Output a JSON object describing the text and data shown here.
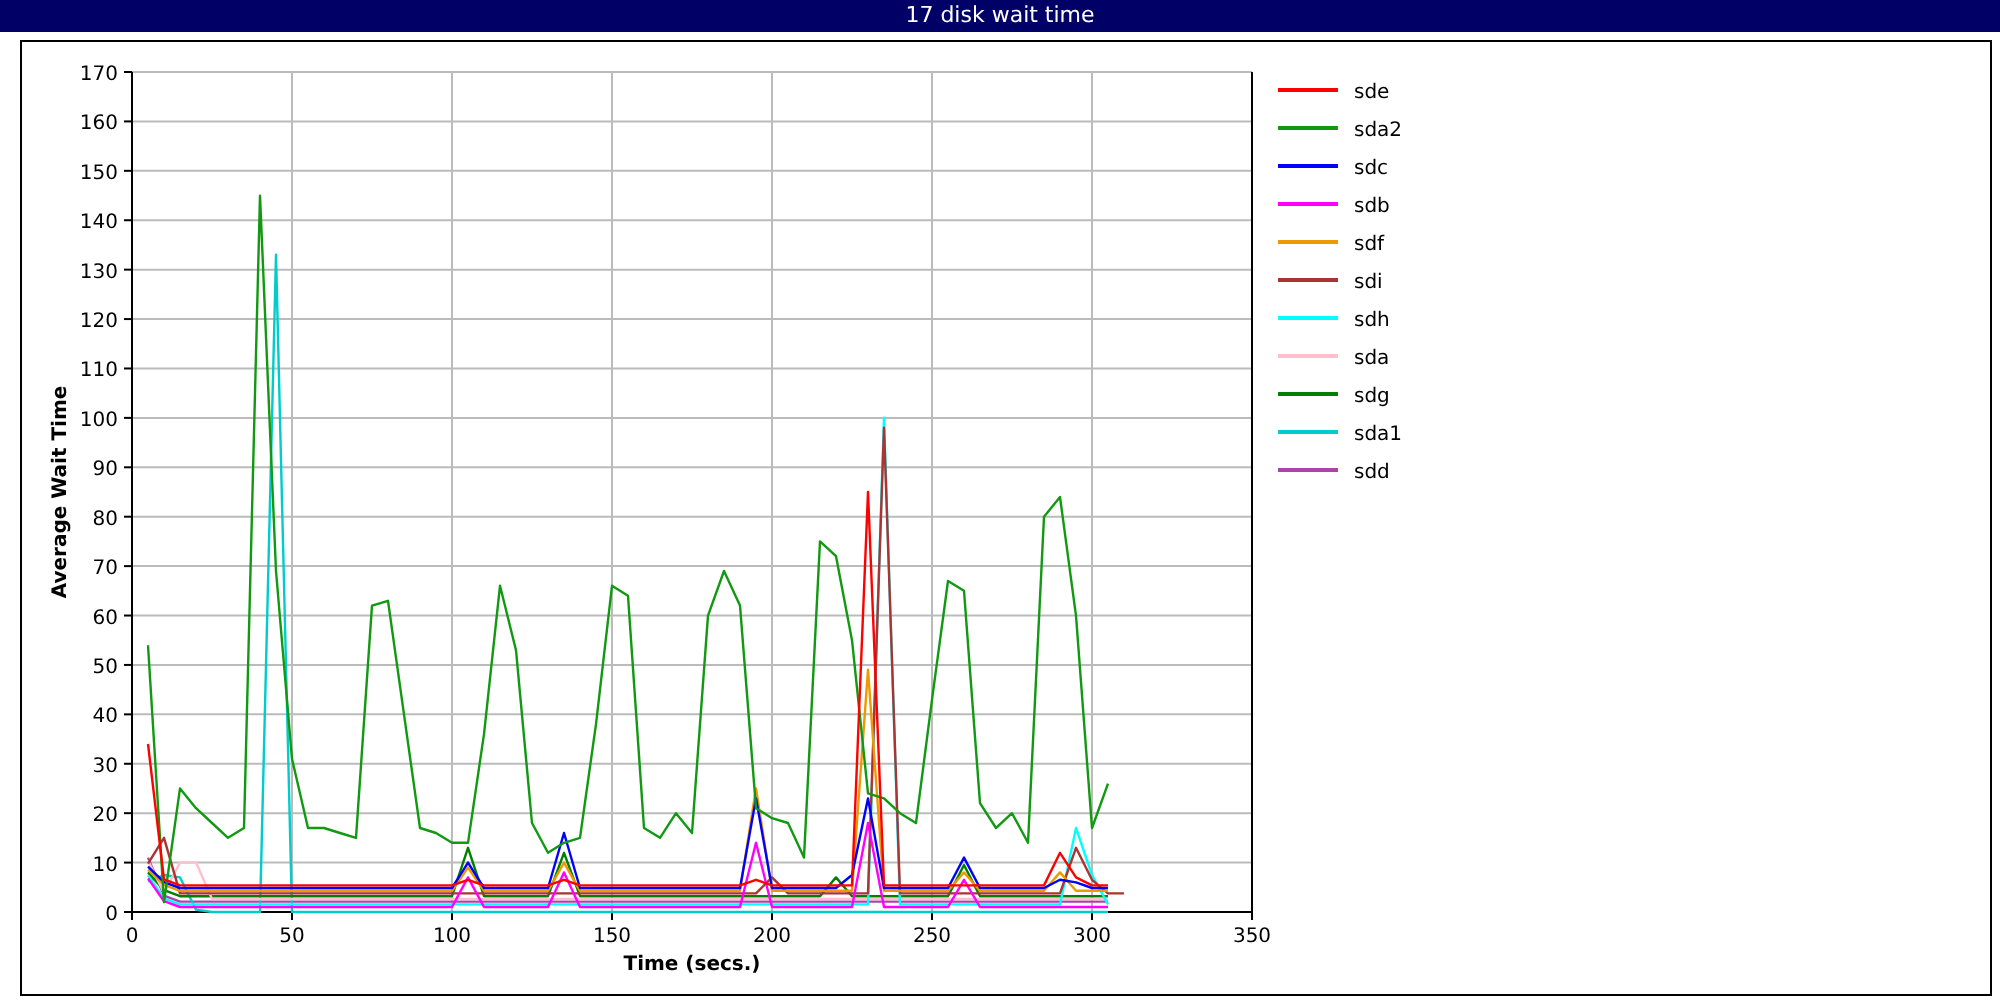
{
  "window": {
    "title": "17 disk wait time"
  },
  "chart": {
    "chart_data": {
      "type": "line",
      "xlabel": "Time (secs.)",
      "ylabel": "Average Wait Time",
      "grid": true,
      "legend": true,
      "x": [
        5,
        10,
        15,
        20,
        25,
        30,
        35,
        40,
        45,
        50,
        55,
        60,
        65,
        70,
        75,
        80,
        85,
        90,
        95,
        100,
        105,
        110,
        115,
        120,
        125,
        130,
        135,
        140,
        145,
        150,
        155,
        160,
        165,
        170,
        175,
        180,
        185,
        190,
        195,
        200,
        205,
        210,
        215,
        220,
        225,
        230,
        235,
        240,
        245,
        250,
        255,
        260,
        265,
        270,
        275,
        280,
        285,
        290,
        295,
        300,
        305,
        310
      ],
      "xlim": [
        0,
        350
      ],
      "ylim": [
        0,
        170
      ],
      "xticks": [
        0,
        50,
        100,
        150,
        200,
        250,
        300,
        350
      ],
      "yticks": [
        0,
        10,
        20,
        30,
        40,
        50,
        60,
        70,
        80,
        90,
        100,
        110,
        120,
        130,
        140,
        150,
        160,
        170
      ],
      "series": [
        {
          "name": "sde",
          "color": "#ff0000",
          "values": [
            34,
            6.6,
            5.4,
            5.4,
            5.4,
            5.4,
            5.4,
            5.4,
            5.4,
            5.4,
            5.4,
            5.4,
            5.4,
            5.4,
            5.4,
            5.4,
            5.4,
            5.4,
            5.4,
            5.4,
            6.5,
            5.4,
            5.4,
            5.4,
            5.4,
            5.4,
            6.5,
            5.4,
            5.4,
            5.4,
            5.4,
            5.4,
            5.4,
            5.4,
            5.4,
            5.4,
            5.4,
            5.4,
            6.5,
            5.4,
            5.4,
            5.4,
            5.4,
            5.4,
            5.4,
            85,
            5.4,
            5.4,
            5.4,
            5.4,
            5.4,
            5.4,
            5.4,
            5.4,
            5.4,
            5.4,
            5.4,
            12,
            7,
            5.4,
            5.4,
            null
          ]
        },
        {
          "name": "sda2",
          "color": "#119911",
          "values": [
            54,
            2,
            25,
            21,
            18,
            15,
            17,
            145,
            69,
            31,
            17,
            17,
            16,
            15,
            62,
            63,
            40,
            17,
            16,
            14,
            14,
            36,
            66,
            53,
            18,
            12,
            14,
            15,
            38,
            66,
            64,
            17,
            15,
            20,
            16,
            60,
            69,
            62,
            21,
            19,
            18,
            11,
            75,
            72,
            55,
            24,
            23,
            20,
            18,
            43,
            67,
            65,
            22,
            17,
            20,
            14,
            80,
            84,
            60,
            17,
            26,
            null
          ]
        },
        {
          "name": "sdc",
          "color": "#0000ff",
          "values": [
            9.2,
            6.05,
            4.85,
            4.85,
            4.85,
            4.85,
            4.85,
            4.85,
            4.85,
            4.85,
            4.85,
            4.85,
            4.85,
            4.85,
            4.85,
            4.85,
            4.85,
            4.85,
            4.85,
            4.85,
            10,
            4.85,
            4.85,
            4.85,
            4.85,
            4.85,
            16,
            4.85,
            4.85,
            4.85,
            4.85,
            4.85,
            4.85,
            4.85,
            4.85,
            4.85,
            4.85,
            4.85,
            23,
            4.85,
            4.85,
            4.85,
            4.85,
            4.85,
            7.5,
            23,
            4.85,
            4.85,
            4.85,
            4.85,
            4.85,
            11,
            4.85,
            4.85,
            4.85,
            4.85,
            4.85,
            6.5,
            6,
            4.85,
            4.85,
            null
          ]
        },
        {
          "name": "sdb",
          "color": "#ff00ff",
          "values": [
            6.8,
            2.2,
            1,
            1,
            1,
            1,
            1,
            1,
            1,
            1,
            1,
            1,
            1,
            1,
            1,
            1,
            1,
            1,
            1,
            1,
            7,
            1,
            1,
            1,
            1,
            1,
            8,
            1,
            1,
            1,
            1,
            1,
            1,
            1,
            1,
            1,
            1,
            1,
            14,
            1,
            1,
            1,
            1,
            1,
            1,
            18,
            1,
            1,
            1,
            1,
            1,
            6.5,
            1,
            1,
            1,
            1,
            1,
            1,
            1,
            1,
            1,
            null
          ]
        },
        {
          "name": "sdf",
          "color": "#ee9900",
          "values": [
            8.6,
            5.5,
            4.3,
            4.3,
            4.3,
            4.3,
            4.3,
            4.3,
            4.3,
            4.3,
            4.3,
            4.3,
            4.3,
            4.3,
            4.3,
            4.3,
            4.3,
            4.3,
            4.3,
            4.3,
            9,
            4.3,
            4.3,
            4.3,
            4.3,
            4.3,
            10,
            4.3,
            4.3,
            4.3,
            4.3,
            4.3,
            4.3,
            4.3,
            4.3,
            4.3,
            4.3,
            4.3,
            25,
            4.3,
            4.3,
            4.3,
            4.3,
            4.3,
            4.3,
            49,
            4.3,
            4.3,
            4.3,
            4.3,
            4.3,
            8,
            4.3,
            4.3,
            4.3,
            4.3,
            4.3,
            8,
            4.3,
            4.3,
            4.3,
            null
          ]
        },
        {
          "name": "sdi",
          "color": "#aa3333",
          "values": [
            9.8,
            15,
            3.75,
            3.75,
            3.75,
            3.75,
            3.75,
            3.75,
            3.75,
            3.75,
            3.75,
            3.75,
            3.75,
            3.75,
            3.75,
            3.75,
            3.75,
            3.75,
            3.75,
            3.75,
            3.75,
            3.75,
            3.75,
            3.75,
            3.75,
            3.75,
            3.75,
            3.75,
            3.75,
            3.75,
            3.75,
            3.75,
            3.75,
            3.75,
            3.75,
            3.75,
            3.75,
            3.75,
            3.75,
            7,
            3.75,
            3.75,
            3.75,
            3.75,
            3.75,
            3.75,
            98,
            3.75,
            3.75,
            3.75,
            3.75,
            3.75,
            3.75,
            3.75,
            3.75,
            3.75,
            3.75,
            3.75,
            13,
            6.5,
            3.75,
            3.75
          ]
        },
        {
          "name": "sdh",
          "color": "#00ffff",
          "values": [
            7.4,
            2.75,
            1.55,
            1.55,
            1.55,
            1.55,
            1.55,
            1.55,
            1.55,
            1.55,
            1.55,
            1.55,
            1.55,
            1.55,
            1.55,
            1.55,
            1.55,
            1.55,
            1.55,
            1.55,
            1.55,
            1.55,
            1.55,
            1.55,
            1.55,
            1.55,
            1.55,
            1.55,
            1.55,
            1.55,
            1.55,
            1.55,
            1.55,
            1.55,
            1.55,
            1.55,
            1.55,
            1.55,
            1.55,
            1.55,
            1.55,
            1.55,
            1.55,
            1.55,
            1.55,
            1.55,
            100,
            1.55,
            1.55,
            1.55,
            1.55,
            1.55,
            1.55,
            1.55,
            1.55,
            1.55,
            1.55,
            1.55,
            17,
            7.5,
            1.55,
            null
          ]
        },
        {
          "name": "sda",
          "color": "#ffc0cb",
          "values": [
            10.4,
            3.85,
            10,
            10,
            2.65,
            2.65,
            2.65,
            2.65,
            2.65,
            2.65,
            2.65,
            2.65,
            2.65,
            2.65,
            2.65,
            2.65,
            2.65,
            2.65,
            2.65,
            2.65,
            2.65,
            2.65,
            2.65,
            2.65,
            2.65,
            2.65,
            2.65,
            2.65,
            2.65,
            2.65,
            2.65,
            2.65,
            2.65,
            2.65,
            2.65,
            2.65,
            2.65,
            2.65,
            2.65,
            2.65,
            2.65,
            2.65,
            2.65,
            2.65,
            2.65,
            2.65,
            2.65,
            2.65,
            2.65,
            2.65,
            2.65,
            2.65,
            2.65,
            2.65,
            2.65,
            2.65,
            2.65,
            2.65,
            2.65,
            2.65,
            2.65,
            null
          ]
        },
        {
          "name": "sdg",
          "color": "#007f00",
          "values": [
            8,
            4.4,
            3.2,
            3.2,
            3.2,
            3.2,
            3.2,
            3.2,
            3.2,
            3.2,
            3.2,
            3.2,
            3.2,
            3.2,
            3.2,
            3.2,
            3.2,
            3.2,
            3.2,
            3.2,
            13,
            3.2,
            3.2,
            3.2,
            3.2,
            3.2,
            12,
            3.2,
            3.2,
            3.2,
            3.2,
            3.2,
            3.2,
            3.2,
            3.2,
            3.2,
            3.2,
            3.2,
            3.2,
            3.2,
            3.2,
            3.2,
            3.2,
            7,
            3.2,
            3.2,
            3.2,
            3.2,
            3.2,
            3.2,
            3.2,
            9.5,
            3.2,
            3.2,
            3.2,
            3.2,
            3.2,
            3.2,
            3.2,
            3.2,
            3.2,
            null
          ]
        },
        {
          "name": "sda1",
          "color": "#00cccc",
          "values": [
            6.2,
            7.5,
            7,
            0.5,
            0,
            0,
            0,
            0,
            133,
            0,
            0,
            0,
            0,
            0,
            0,
            0,
            0,
            0,
            0,
            0,
            0,
            0,
            0,
            0,
            0,
            0,
            0,
            0,
            0,
            0,
            0,
            0,
            0,
            0,
            0,
            0,
            0,
            0,
            0,
            0,
            0,
            0,
            0,
            0,
            0,
            0,
            0,
            0,
            0,
            0,
            0,
            0,
            0,
            0,
            0,
            0,
            0,
            0,
            0,
            0,
            0,
            null
          ]
        },
        {
          "name": "sdd",
          "color": "#aa44aa",
          "values": [
            11,
            3.3,
            2.1,
            2.1,
            2.1,
            2.1,
            2.1,
            2.1,
            2.1,
            2.1,
            2.1,
            2.1,
            2.1,
            2.1,
            2.1,
            2.1,
            2.1,
            2.1,
            2.1,
            2.1,
            2.1,
            2.1,
            2.1,
            2.1,
            2.1,
            2.1,
            2.1,
            2.1,
            2.1,
            2.1,
            2.1,
            2.1,
            2.1,
            2.1,
            2.1,
            2.1,
            2.1,
            2.1,
            2.1,
            2.1,
            2.1,
            2.1,
            2.1,
            2.1,
            2.1,
            2.1,
            2.1,
            2.1,
            2.1,
            2.1,
            2.1,
            2.1,
            2.1,
            2.1,
            2.1,
            2.1,
            2.1,
            2.1,
            2.1,
            2.1,
            2.1,
            null
          ]
        }
      ]
    }
  }
}
